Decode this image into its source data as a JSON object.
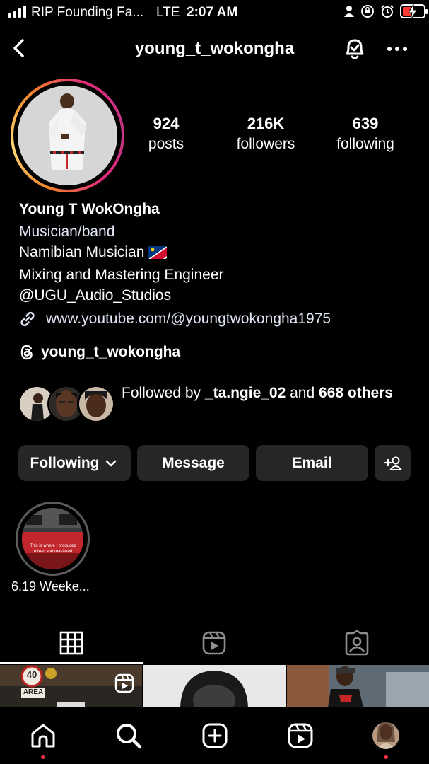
{
  "status_bar": {
    "carrier": "RIP Founding Fa...",
    "network": "LTE",
    "time": "2:07 AM"
  },
  "header": {
    "username": "young_t_wokongha"
  },
  "stats": {
    "posts_count": "924",
    "posts_label": "posts",
    "followers_count": "216K",
    "followers_label": "followers",
    "following_count": "639",
    "following_label": "following"
  },
  "bio": {
    "display_name": "Young T WokOngha",
    "category": "Musician/band",
    "line1": "Namibian Musician",
    "line2": "Mixing and Mastering Engineer",
    "line3": "@UGU_Audio_Studios",
    "link": "www.youtube.com/@youngtwokongha1975",
    "threads_handle": "young_t_wokongha"
  },
  "followed_by": {
    "prefix": "Followed by ",
    "user": "_ta.ngie_02",
    "middle": " and ",
    "others": "668 others"
  },
  "actions": {
    "following_label": "Following",
    "message_label": "Message",
    "email_label": "Email"
  },
  "highlights": [
    {
      "label": "6.19 Weeke...",
      "thumb_text": "This is where I produced mixed and mastered"
    }
  ],
  "tabs": [
    {
      "icon": "grid-icon",
      "active": true
    },
    {
      "icon": "reels-icon",
      "active": false
    },
    {
      "icon": "tagged-icon",
      "active": false
    }
  ],
  "grid_posts": [
    {
      "sign_text": "40",
      "sign_sub": "AREA",
      "type": "reel"
    },
    {
      "type": "photo"
    },
    {
      "type": "photo"
    }
  ],
  "bottom_nav": [
    "home-icon",
    "search-icon",
    "create-icon",
    "reels-icon",
    "profile-icon"
  ],
  "colors": {
    "background": "#000000",
    "button": "#262626",
    "notification_dot": "#ff3040",
    "link": "#e0e6f4"
  }
}
